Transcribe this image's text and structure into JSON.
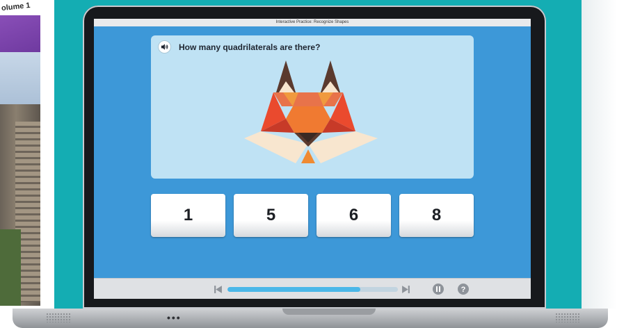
{
  "book": {
    "title_fragment": "olume 1"
  },
  "window": {
    "title": "Interactive Practice: Recognize Shapes"
  },
  "question": {
    "text": "How many quadrilaterals are there?",
    "audio_icon": "speaker-icon"
  },
  "answers": [
    {
      "label": "1"
    },
    {
      "label": "5"
    },
    {
      "label": "6"
    },
    {
      "label": "8"
    }
  ],
  "controls": {
    "progress": 0.78,
    "icons": [
      "skip-back-icon",
      "skip-forward-icon",
      "pause-icon",
      "help-icon"
    ]
  },
  "colors": {
    "screen_bg": "#3d98d8",
    "panel_bg": "#bfe2f4",
    "teal_backdrop": "#14adb3",
    "progress_fill": "#4bb7e8"
  }
}
